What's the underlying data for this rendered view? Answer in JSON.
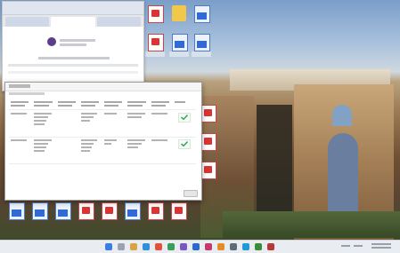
{
  "window": {
    "title": ""
  },
  "browser": {
    "tabs": [
      "",
      "",
      ""
    ]
  },
  "dialog": {
    "title": "",
    "subtitle": "",
    "columns": [
      "",
      "",
      "",
      "",
      "",
      "",
      "",
      ""
    ],
    "rows": [
      {
        "cells": [
          "",
          "",
          "",
          "",
          "",
          "",
          "",
          ""
        ]
      },
      {
        "cells": [
          "",
          "",
          "",
          "",
          "",
          "",
          "",
          ""
        ]
      }
    ],
    "close_label": ""
  },
  "desktop": {
    "icons": [
      "",
      "",
      "",
      "",
      "",
      "",
      "",
      "",
      "",
      "",
      "",
      "",
      "",
      "",
      "",
      ""
    ]
  },
  "taskbar": {
    "time": "",
    "date": ""
  },
  "colors": {
    "accent": "#2f6ad6",
    "confirm_check": "#2e9d4a",
    "pdf_red": "#d33333"
  }
}
